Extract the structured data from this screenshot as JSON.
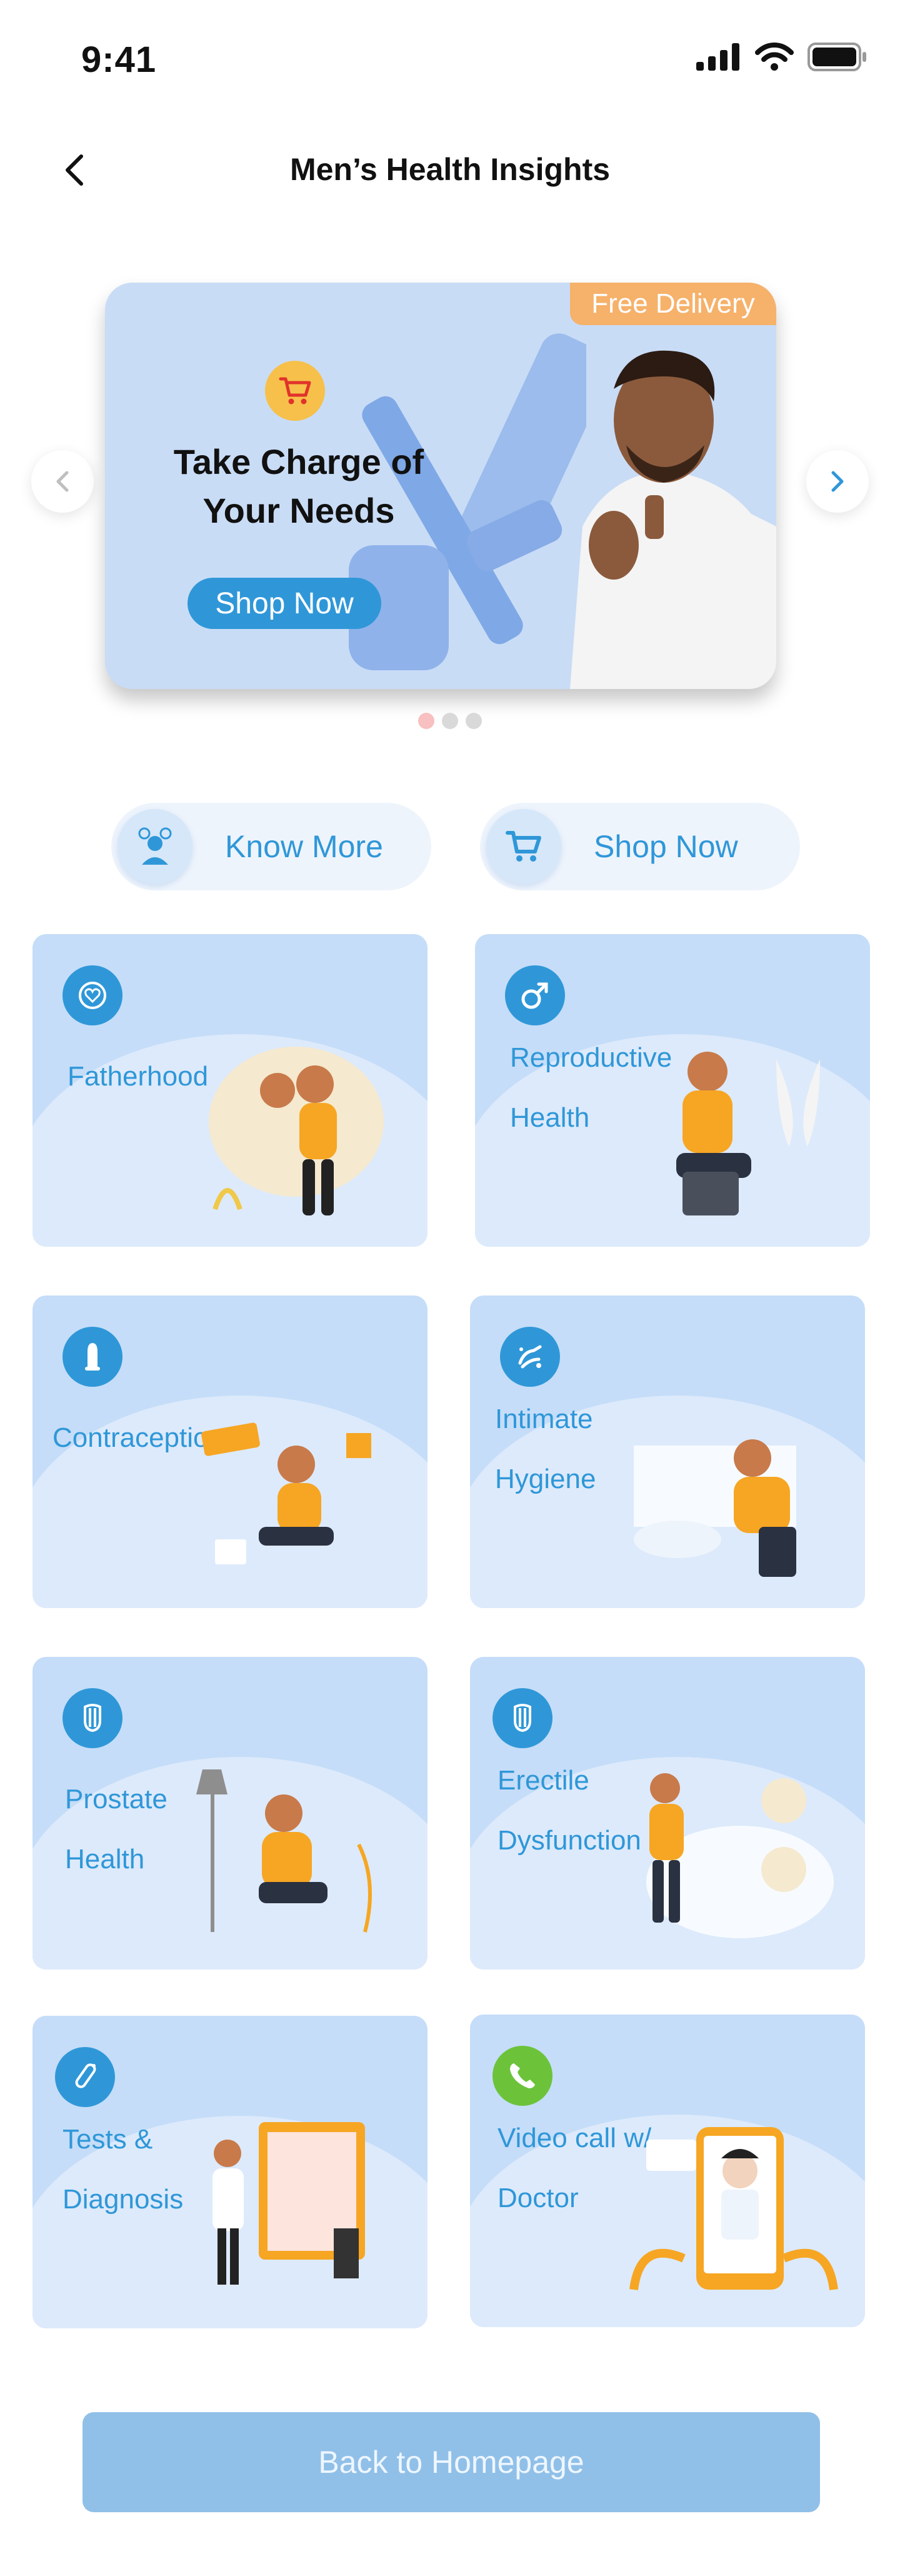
{
  "status_bar": {
    "time": "9:41"
  },
  "header": {
    "title": "Men’s Health Insights"
  },
  "banner": {
    "badge": "Free Delivery",
    "headline_line1": "Take Charge of",
    "headline_line2": "Your Needs",
    "cta": "Shop Now",
    "dots": 3,
    "active_dot": 0
  },
  "quick_actions": {
    "know_more": "Know More",
    "shop_now": "Shop Now"
  },
  "cards": [
    {
      "line1": "Fatherhood",
      "line2": "",
      "icon": "heart-icon"
    },
    {
      "line1": "Reproductive",
      "line2": "Health",
      "icon": "male-symbol-icon"
    },
    {
      "line1": "Contraception",
      "line2": "",
      "icon": "condom-icon"
    },
    {
      "line1": "Intimate",
      "line2": "Hygiene",
      "icon": "hand-washing-icon"
    },
    {
      "line1": "Prostate",
      "line2": "Health",
      "icon": "prostate-icon"
    },
    {
      "line1": "Erectile",
      "line2": "Dysfunction",
      "icon": "prostate-icon"
    },
    {
      "line1": "Tests &",
      "line2": "Diagnosis",
      "icon": "test-tube-icon"
    },
    {
      "line1": "Video call w/",
      "line2": "Doctor",
      "icon": "phone-icon"
    }
  ],
  "colors": {
    "accent": "#2f97d8",
    "card_bg": "#c5ddf8",
    "badge": "#f6b16a",
    "call_green": "#6cc33a",
    "bottom_button": "#90c0e8"
  },
  "footer": {
    "back_label": "Back to Homepage"
  }
}
